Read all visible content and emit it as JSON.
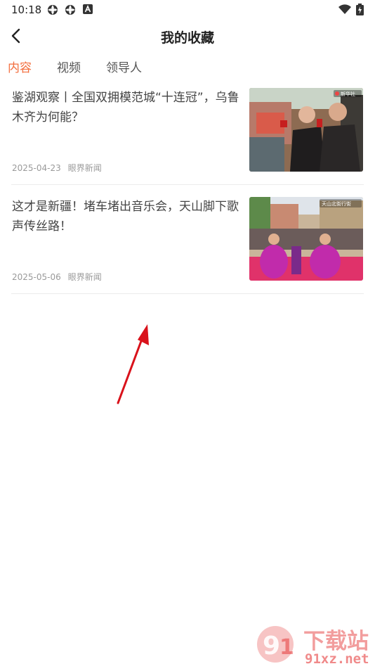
{
  "status_bar": {
    "time": "10:18"
  },
  "header": {
    "title": "我的收藏"
  },
  "tabs": [
    {
      "label": "内容",
      "active": true
    },
    {
      "label": "视频",
      "active": false
    },
    {
      "label": "领导人",
      "active": false
    }
  ],
  "articles": [
    {
      "title": "鉴湖观察丨全国双拥模范城“十连冠”，乌鲁木齐为何能？",
      "date": "2025-04-23",
      "source": "眼界新闻",
      "thumb_badge": "新华社"
    },
    {
      "title": "这才是新疆！堵车堵出音乐会，天山脚下歌声传丝路！",
      "date": "2025-05-06",
      "source": "眼界新闻",
      "thumb_badge": "天山北街行街"
    }
  ],
  "watermark": {
    "brand": "下载站",
    "site": "91xz.net"
  },
  "colors": {
    "accent": "#f36e3e",
    "annotation_arrow": "#d9121b"
  },
  "icons": [
    "chevron-left-icon",
    "wifi-icon",
    "battery-icon",
    "gear-icon",
    "a-icon"
  ]
}
